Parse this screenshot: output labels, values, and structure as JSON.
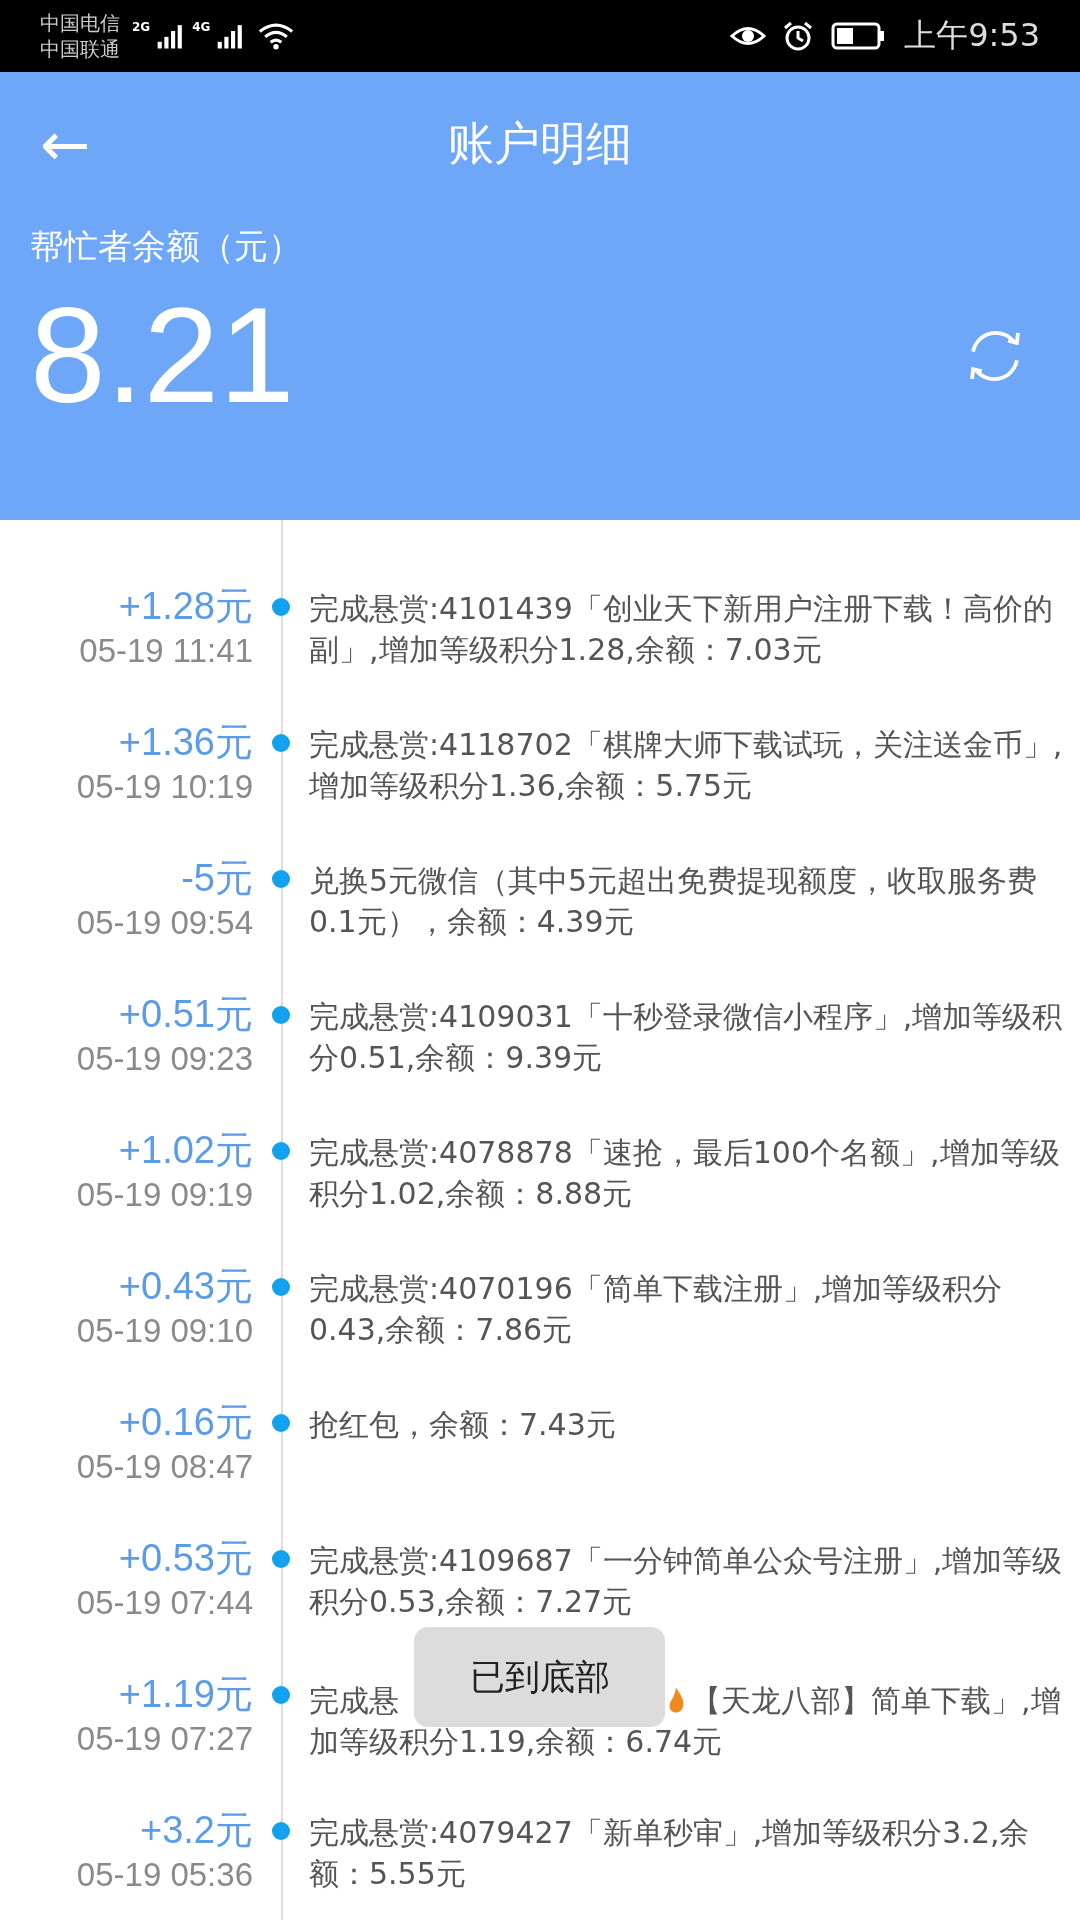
{
  "status_bar": {
    "carriers": [
      "中国电信",
      "中国联通"
    ],
    "network_types": [
      "2G",
      "4G"
    ],
    "time": "上午9:53"
  },
  "header": {
    "back": "←",
    "title": "账户明细",
    "balance_label": "帮忙者余额（元）",
    "balance": "8.21"
  },
  "records": [
    {
      "kind": "plain",
      "amount": "+1.28元",
      "time": "05-19 11:41",
      "text": "完成悬赏:4101439「创业天下新用户注册下载！高价的副」,增加等级积分1.28,余额：7.03元"
    },
    {
      "kind": "plain",
      "amount": "+1.36元",
      "time": "05-19 10:19",
      "text": "完成悬赏:4118702「棋牌大师下载试玩，关注送金币」,增加等级积分1.36,余额：5.75元"
    },
    {
      "kind": "plain",
      "amount": "-5元",
      "time": "05-19 09:54",
      "text": "兑换5元微信（其中5元超出免费提现额度，收取服务费0.1元），余额：4.39元"
    },
    {
      "kind": "plain",
      "amount": "+0.51元",
      "time": "05-19 09:23",
      "text": "完成悬赏:4109031「十秒登录微信小程序」,增加等级积分0.51,余额：9.39元"
    },
    {
      "kind": "plain",
      "amount": "+1.02元",
      "time": "05-19 09:19",
      "text": "完成悬赏:4078878「速抢，最后100个名额」,增加等级积分1.02,余额：8.88元"
    },
    {
      "kind": "plain",
      "amount": "+0.43元",
      "time": "05-19 09:10",
      "text": "完成悬赏:4070196「简单下载注册」,增加等级积分0.43,余额：7.86元"
    },
    {
      "kind": "plain",
      "amount": "+0.16元",
      "time": "05-19 08:47",
      "text": "抢红包，余额：7.43元"
    },
    {
      "kind": "plain",
      "amount": "+0.53元",
      "time": "05-19 07:44",
      "text": "完成悬赏:4109687「一分钟简单公众号注册」,增加等级积分0.53,余额：7.27元"
    },
    {
      "kind": "covered",
      "amount": "+1.19元",
      "time": "05-19 07:27",
      "text_before": "完成悬",
      "text_after": "【天龙八部】简单下载」,增加等级积分1.19,余额：6.74元"
    },
    {
      "kind": "plain",
      "amount": "+3.2元",
      "time": "05-19 05:36",
      "text": "完成悬赏:4079427「新单秒审」,增加等级积分3.2,余额：5.55元"
    }
  ],
  "toast": "已到底部"
}
